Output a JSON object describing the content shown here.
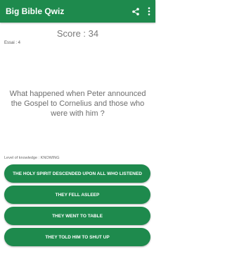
{
  "app": {
    "title": "Big Bible Qwiz"
  },
  "icons": {
    "share": "share-icon",
    "menu": "more-vert-icon"
  },
  "score": {
    "text": "Score : 34"
  },
  "tries": {
    "text": "Essai : 4"
  },
  "question": {
    "text": "What happened when Peter announced the Gospel to Cornelius and those who were with him ?"
  },
  "level": {
    "text": "Level of knowledge : KNOWING"
  },
  "answers": [
    {
      "label": "THE HOLY SPIRIT DESCENDED UPON ALL WHO LISTENED"
    },
    {
      "label": "THEY FELL ASLEEP"
    },
    {
      "label": "THEY WENT TO TABLE"
    },
    {
      "label": "THEY TOLD HIM TO SHUT UP"
    }
  ],
  "colors": {
    "primary": "#1e8a4d",
    "background": "#ffffff"
  }
}
